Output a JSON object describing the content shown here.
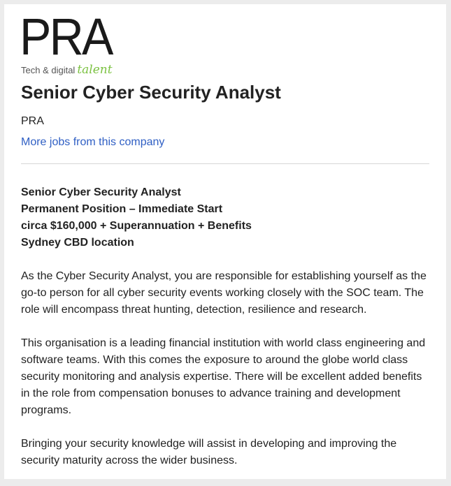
{
  "logo": {
    "letters": "PRA",
    "tagline": "Tech & digital",
    "tagline_accent": "talent"
  },
  "job": {
    "title": "Senior Cyber Security Analyst",
    "company": "PRA",
    "more_jobs_link": "More jobs from this company"
  },
  "description": {
    "highlights": [
      "Senior Cyber Security Analyst",
      "Permanent Position – Immediate Start",
      "circa $160,000 + Superannuation + Benefits",
      "Sydney CBD location"
    ],
    "paragraphs": [
      "As the Cyber Security Analyst, you are responsible for establishing yourself as the go-to person for all cyber security events working closely with the SOC team. The role will encompass threat hunting, detection, resilience and research.",
      "This organisation is a leading financial institution with world class engineering and software teams. With this comes the exposure to around the globe world class security monitoring and analysis expertise. There will be excellent added benefits in the role from compensation bonuses to advance training and development programs.",
      "Bringing your security knowledge will assist in developing and improving the security maturity across the wider business."
    ]
  },
  "colors": {
    "link": "#2f5fc4",
    "logo_accent": "#7cc242",
    "text": "#222222"
  }
}
